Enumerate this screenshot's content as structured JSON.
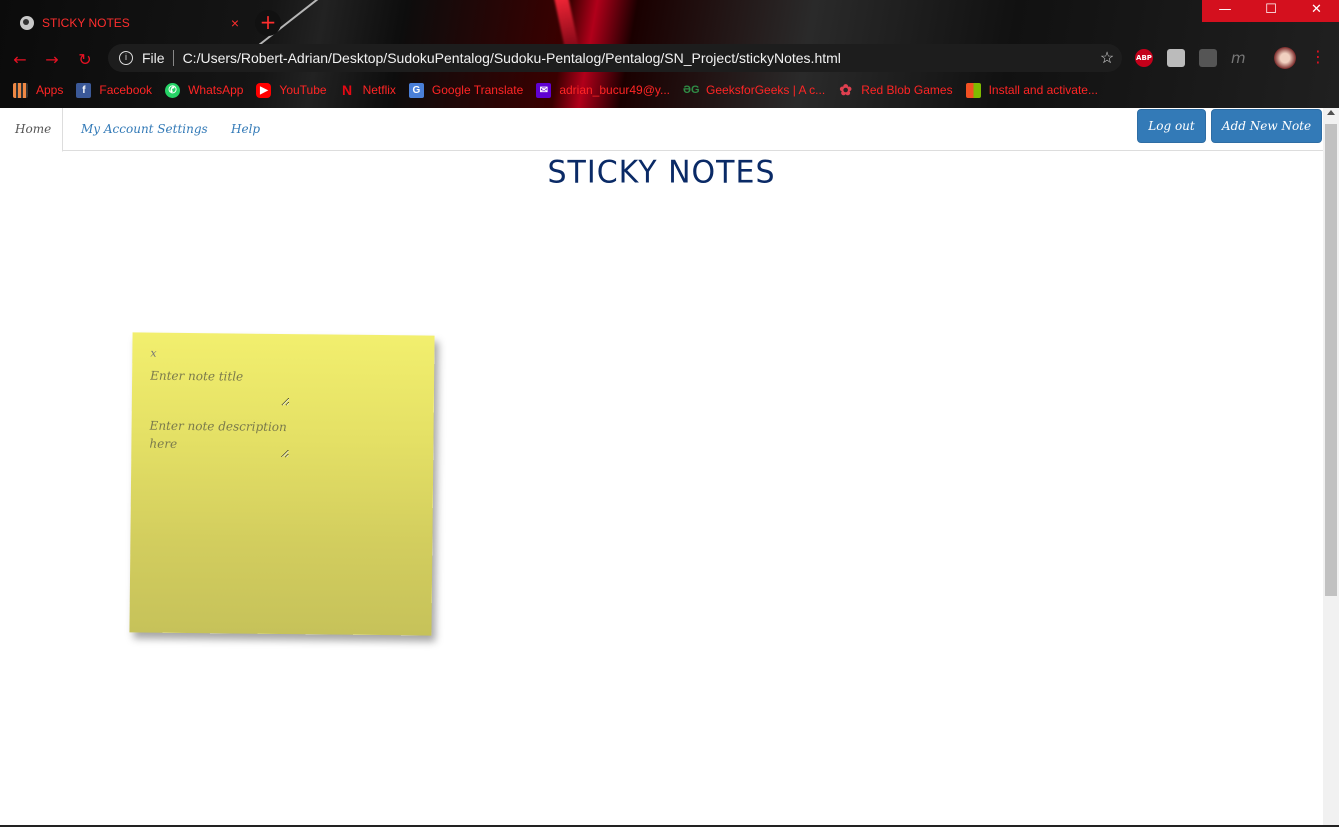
{
  "browser": {
    "tab_title": "STICKY NOTES",
    "tab_close": "×",
    "new_tab": "+",
    "window_controls": {
      "minimize": "—",
      "maximize": "☐",
      "close": "✕"
    },
    "nav": {
      "back": "←",
      "forward": "→",
      "reload": "↻"
    },
    "omnibox": {
      "info": "i",
      "scheme": "File",
      "url": "C:/Users/Robert-Adrian/Desktop/SudokuPentalog/Sudoku-Pentalog/Pentalog/SN_Project/stickyNotes.html",
      "star": "☆"
    },
    "extensions": {
      "abp": "ABP",
      "m": "m"
    },
    "menu": "⋮",
    "bookmarks": [
      {
        "label": "Apps",
        "icon": "apps-icon",
        "glyph": ""
      },
      {
        "label": "Facebook",
        "icon": "facebook-icon",
        "glyph": "f"
      },
      {
        "label": "WhatsApp",
        "icon": "whatsapp-icon",
        "glyph": "✆"
      },
      {
        "label": "YouTube",
        "icon": "youtube-icon",
        "glyph": "▶"
      },
      {
        "label": "Netflix",
        "icon": "netflix-icon",
        "glyph": "N"
      },
      {
        "label": "Google Translate",
        "icon": "google-translate-icon",
        "glyph": "G"
      },
      {
        "label": "adrian_bucur49@y...",
        "icon": "yahoo-mail-icon",
        "glyph": "✉"
      },
      {
        "label": "GeeksforGeeks | A c...",
        "icon": "geeksforgeeks-icon",
        "glyph": "ƏG"
      },
      {
        "label": "Red Blob Games",
        "icon": "red-blob-games-icon",
        "glyph": "✿"
      },
      {
        "label": "Install and activate...",
        "icon": "microsoft-icon",
        "glyph": ""
      }
    ]
  },
  "page": {
    "nav_tabs": [
      "Home",
      "My Account Settings",
      "Help"
    ],
    "logout_label": "Log out",
    "add_note_label": "Add New Note",
    "title": "STICKY NOTES",
    "note": {
      "close_label": "x",
      "title_placeholder": "Enter note title",
      "description_placeholder": "Enter note description here"
    }
  },
  "colors": {
    "accent": "#337ab7",
    "title": "#0a2a66",
    "note_top": "#f2ef6e",
    "note_bottom": "#c6c25a",
    "chrome_red": "#e81123"
  }
}
